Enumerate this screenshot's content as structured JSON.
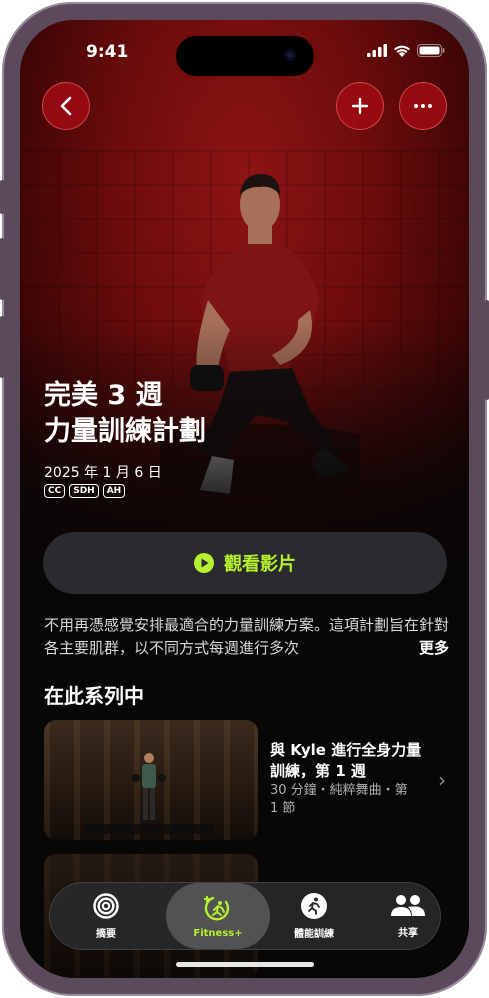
{
  "status_bar": {
    "time": "9:41"
  },
  "nav": {
    "back_icon": "chevron-left-icon",
    "add_icon": "plus-icon",
    "more_icon": "ellipsis-icon"
  },
  "program": {
    "title_line1": "完美 3 週",
    "title_line2": "力量訓練計劃",
    "date": "2025 年 1 月 6 日",
    "badges": [
      "CC",
      "SDH",
      "AH"
    ]
  },
  "watch_button": {
    "label": "觀看影片",
    "icon": "play-circle-icon"
  },
  "description": {
    "text": "不用再憑感覺安排最適合的力量訓練方案。這項計劃旨在針對各主要肌群，以不同方式每週進行多次",
    "more_label": "更多"
  },
  "series": {
    "title": "在此系列中",
    "episodes": [
      {
        "title": "與 Kyle 進行全身力量訓練，第 1 週",
        "meta": "30 分鐘・純粹舞曲・第 1 節"
      }
    ]
  },
  "tabbar": {
    "tabs": [
      {
        "label": "摘要",
        "icon": "rings-icon",
        "active": false
      },
      {
        "label": "Fitness+",
        "icon": "fitness-plus-icon",
        "active": true
      },
      {
        "label": "體能訓練",
        "icon": "running-figure-icon",
        "active": false
      },
      {
        "label": "共享",
        "icon": "people-icon",
        "active": false
      }
    ]
  },
  "colors": {
    "accent": "#b6f02e",
    "hero_red": "#7a0e0e",
    "nav_button": "#a00a14"
  }
}
